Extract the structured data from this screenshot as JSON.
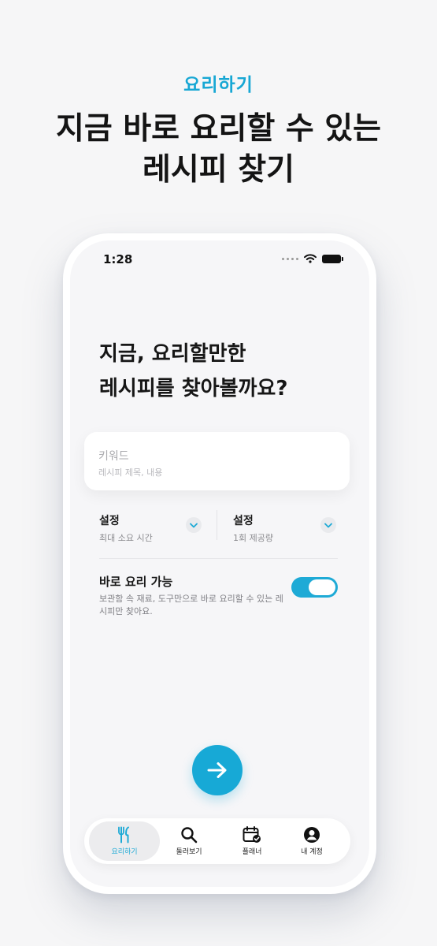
{
  "promo": {
    "tag": "요리하기",
    "title_line1": "지금 바로 요리할 수 있는",
    "title_line2": "레시피 찾기"
  },
  "status_bar": {
    "time": "1:28",
    "icons": [
      "dots-icon",
      "wifi-icon",
      "battery-icon"
    ]
  },
  "headline": {
    "line1": "지금, 요리할만한",
    "line2": "레시피를 찾아볼까요?"
  },
  "keyword_field": {
    "label": "키워드",
    "hint": "레시피 제목, 내용"
  },
  "settings": [
    {
      "title": "설정",
      "value": "최대 소요 시간"
    },
    {
      "title": "설정",
      "value": "1회 제공량"
    }
  ],
  "cook_now": {
    "title": "바로 요리 가능",
    "description": "보관함 속 재료, 도구만으로 바로 요리할 수 있는 레시피만 찾아요.",
    "enabled": true
  },
  "next_button": {
    "icon": "arrow-right-icon"
  },
  "tabs": [
    {
      "label": "요리하기",
      "icon": "utensils-icon",
      "active": true
    },
    {
      "label": "둘러보기",
      "icon": "search-icon",
      "active": false
    },
    {
      "label": "플래너",
      "icon": "calendar-check-icon",
      "active": false
    },
    {
      "label": "내 계정",
      "icon": "account-icon",
      "active": false
    }
  ],
  "colors": {
    "accent": "#17a9d6",
    "background": "#f6f6f7",
    "text": "#1b1b1b"
  }
}
